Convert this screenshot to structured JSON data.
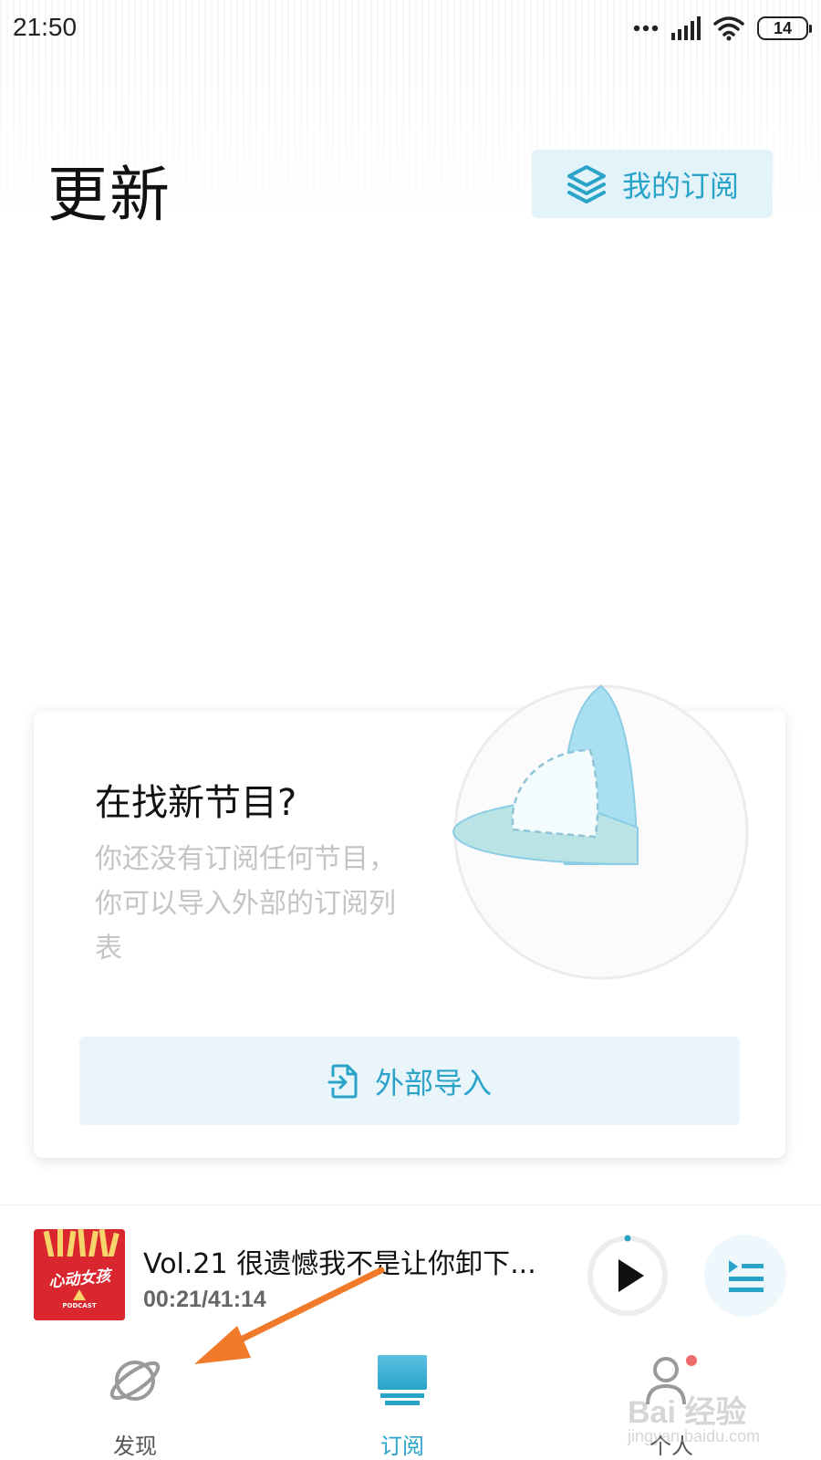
{
  "status_bar": {
    "time": "21:50",
    "battery": "14",
    "icons": [
      "more-dots-icon",
      "signal-icon",
      "wifi-icon",
      "battery-icon"
    ]
  },
  "header": {
    "title": "更新",
    "my_subscriptions_label": "我的订阅"
  },
  "empty_card": {
    "title": "在找新节目?",
    "description": "你还没有订阅任何节目，你可以导入外部的订阅列表",
    "import_label": "外部导入"
  },
  "player": {
    "track_title": "Vol.21 很遗憾我不是让你卸下...",
    "time": "00:21/41:14",
    "cover_text": "心动女孩",
    "cover_sub": "PODCAST"
  },
  "nav": {
    "items": [
      {
        "label": "发现",
        "icon": "planet-icon"
      },
      {
        "label": "订阅",
        "icon": "subscriptions-icon",
        "active": true
      },
      {
        "label": "个人",
        "icon": "profile-icon"
      }
    ]
  },
  "watermark": {
    "text": "Bai 经验",
    "sub": "jingyan.baidu.com"
  },
  "colors": {
    "accent": "#2aa3c9",
    "accent_bg": "#e3f3fa",
    "annotation_arrow": "#f07a2a",
    "notification_dot": "#f06b6b"
  }
}
